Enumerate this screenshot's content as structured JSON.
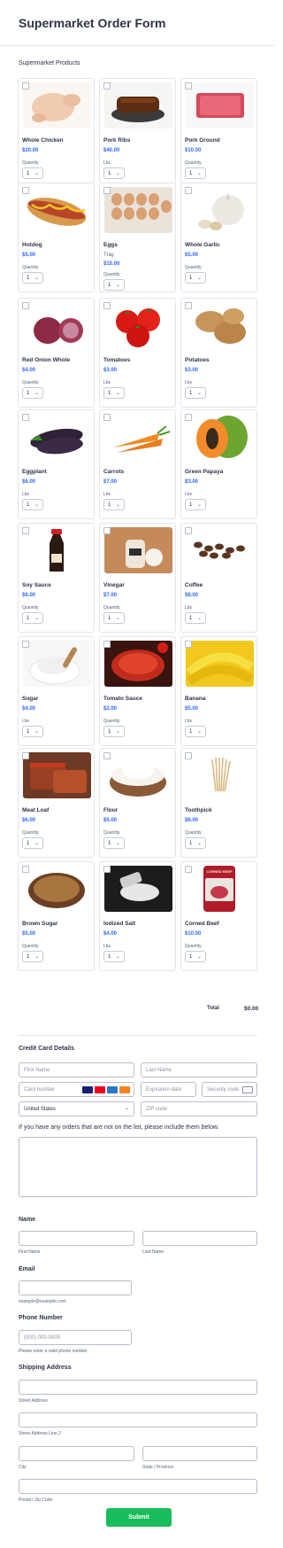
{
  "header": {
    "title": "Supermarket Order Form"
  },
  "products_section": {
    "label": "Supermarket Products"
  },
  "products": [
    {
      "name": "Whole Chicken",
      "price": "$20.00",
      "qty_label": "Quantity",
      "qty": "1",
      "img": "chicken"
    },
    {
      "name": "Pork Ribs",
      "price": "$40.00",
      "qty_label": "Lbs",
      "qty": "1",
      "img": "ribs"
    },
    {
      "name": "Pork Ground",
      "price": "$10.00",
      "qty_label": "Quantity",
      "qty": "1",
      "img": "ground"
    },
    {
      "name": "Hotdog",
      "price": "$5.00",
      "qty_label": "Quantity",
      "qty": "1",
      "img": "hotdog"
    },
    {
      "name": "Eggs",
      "sub": "Tray",
      "price": "$10.00",
      "qty_label": "Quantity",
      "qty": "1",
      "img": "eggs"
    },
    {
      "name": "Whole Garlic",
      "price": "$5.00",
      "qty_label": "Quantity",
      "qty": "1",
      "img": "garlic"
    },
    {
      "name": "Red Onion Whole",
      "price": "$4.00",
      "qty_label": "Quantity",
      "qty": "1",
      "img": "onion"
    },
    {
      "name": "Tomatoes",
      "price": "$3.00",
      "qty_label": "Lbs",
      "qty": "1",
      "img": "tomato"
    },
    {
      "name": "Potatoes",
      "price": "$3.00",
      "qty_label": "Lbs",
      "qty": "1",
      "img": "potato"
    },
    {
      "name": "Eggplant",
      "price": "$6.00",
      "qty_label": "Lbs",
      "qty": "1",
      "img": "eggplant"
    },
    {
      "name": "Carrots",
      "price": "$7.00",
      "qty_label": "Lbs",
      "qty": "1",
      "img": "carrot"
    },
    {
      "name": "Green Papaya",
      "price": "$3.00",
      "qty_label": "Lbs",
      "qty": "1",
      "img": "papaya"
    },
    {
      "name": "Soy Sauce",
      "price": "$6.00",
      "qty_label": "Quantity",
      "qty": "1",
      "img": "soy"
    },
    {
      "name": "Vinegar",
      "price": "$7.00",
      "qty_label": "Quantity",
      "qty": "1",
      "img": "vinegar"
    },
    {
      "name": "Coffee",
      "price": "$8.00",
      "qty_label": "Lbs",
      "qty": "1",
      "img": "coffee"
    },
    {
      "name": "Sugar",
      "price": "$4.00",
      "qty_label": "Lbs",
      "qty": "1",
      "img": "sugar"
    },
    {
      "name": "Tomato Sauce",
      "price": "$2.00",
      "qty_label": "Quantity",
      "qty": "1",
      "img": "sauce"
    },
    {
      "name": "Banana",
      "price": "$5.00",
      "qty_label": "Lbs",
      "qty": "1",
      "img": "banana"
    },
    {
      "name": "Meat Loaf",
      "price": "$6.00",
      "qty_label": "Quantity",
      "qty": "1",
      "img": "meatloaf"
    },
    {
      "name": "Flour",
      "price": "$5.00",
      "qty_label": "Quantity",
      "qty": "1",
      "img": "flour"
    },
    {
      "name": "Toothpick",
      "price": "$6.00",
      "qty_label": "Quantity",
      "qty": "1",
      "img": "toothpick"
    },
    {
      "name": "Brown Sugar",
      "price": "$5.00",
      "qty_label": "Quantity",
      "qty": "1",
      "img": "brownsugar"
    },
    {
      "name": "Iodized Salt",
      "price": "$4.00",
      "qty_label": "Lbs",
      "qty": "1",
      "img": "salt"
    },
    {
      "name": "Corned Beef",
      "price": "$10.00",
      "qty_label": "Quantity",
      "qty": "1",
      "img": "cornedbeef"
    }
  ],
  "corned_beef_logo_text": "CORNED BEEF",
  "total": {
    "label": "Total",
    "value": "$0.00"
  },
  "credit_card": {
    "label": "Credit Card Details",
    "first_name_placeholder": "First Name",
    "last_name_placeholder": "Last Name",
    "card_number_placeholder": "Card number",
    "expiration_placeholder": "Expiration date",
    "security_placeholder": "Security code",
    "country_value": "United States",
    "zip_placeholder": "ZIP code",
    "card_brands": [
      "visa",
      "mastercard",
      "amex",
      "discover"
    ],
    "colors": {
      "visa": "#1a1f71",
      "mastercard": "#eb001b",
      "amex": "#2e77bc",
      "discover": "#f58220"
    }
  },
  "other_orders": {
    "question": "If you have any orders that are not on the list, please include them below."
  },
  "name_section": {
    "label": "Name",
    "first_sub": "First Name",
    "last_sub": "Last Name"
  },
  "email_section": {
    "label": "Email",
    "sub": "example@example.com"
  },
  "phone_section": {
    "label": "Phone Number",
    "placeholder": "(000) 000-0000",
    "sub": "Please enter a valid phone number."
  },
  "shipping_section": {
    "label": "Shipping Address",
    "street_sub": "Street Address",
    "street2_sub": "Street Address Line 2",
    "city_sub": "City",
    "state_sub": "State / Province",
    "postal_sub": "Postal / Zip Code"
  },
  "submit": {
    "label": "Submit"
  },
  "colors": {
    "accent": "#2e69ff",
    "submit": "#18bd5b",
    "border": "#b8bdc9"
  }
}
